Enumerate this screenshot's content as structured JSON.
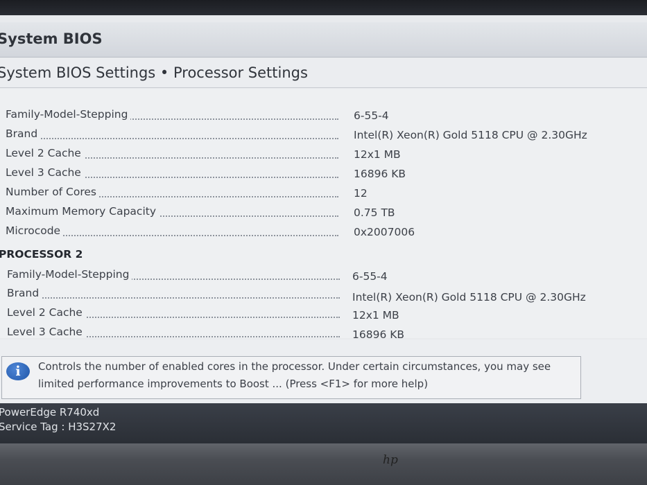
{
  "window": {
    "title": "System BIOS"
  },
  "section": {
    "title": "System BIOS Settings • Processor Settings"
  },
  "processor1": {
    "rows": [
      {
        "label": "Family-Model-Stepping",
        "value": "6-55-4"
      },
      {
        "label": "Brand",
        "value": "Intel(R) Xeon(R) Gold 5118 CPU @ 2.30GHz"
      },
      {
        "label": "Level 2 Cache",
        "value": "12x1 MB"
      },
      {
        "label": "Level 3 Cache",
        "value": "16896 KB"
      },
      {
        "label": "Number of Cores",
        "value": "12"
      },
      {
        "label": "Maximum Memory Capacity",
        "value": "0.75 TB"
      },
      {
        "label": "Microcode",
        "value": "0x2007006"
      }
    ]
  },
  "processor2": {
    "title": "PROCESSOR 2",
    "rows": [
      {
        "label": "Family-Model-Stepping",
        "value": "6-55-4"
      },
      {
        "label": "Brand",
        "value": "Intel(R) Xeon(R) Gold 5118 CPU @ 2.30GHz"
      },
      {
        "label": "Level 2 Cache",
        "value": "12x1 MB"
      },
      {
        "label": "Level 3 Cache",
        "value": "16896 KB"
      }
    ]
  },
  "help": {
    "icon": "info-icon",
    "text": "Controls the number of enabled cores in the processor. Under certain circumstances, you may see limited performance improvements to Boost ... (Press <F1> for more help)"
  },
  "footer": {
    "model": "PowerEdge R740xd",
    "service_tag": "Service Tag : H3S27X2"
  },
  "bezel": {
    "logo": "hp"
  },
  "colors": {
    "accent": "#1f56a8",
    "footer_bg": "#2f333a",
    "background": "#eef0f2"
  }
}
